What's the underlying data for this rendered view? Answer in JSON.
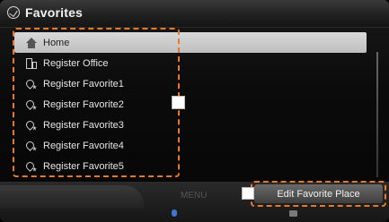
{
  "header": {
    "title": "Favorites",
    "icon": "favorites-icon"
  },
  "favorites": {
    "items": [
      {
        "label": "Home",
        "icon": "home-icon",
        "selected": true
      },
      {
        "label": "Register Office",
        "icon": "office-icon",
        "selected": false
      },
      {
        "label": "Register Favorite1",
        "icon": "favorite-place-icon",
        "selected": false
      },
      {
        "label": "Register Favorite2",
        "icon": "favorite-place-icon",
        "selected": false
      },
      {
        "label": "Register Favorite3",
        "icon": "favorite-place-icon",
        "selected": false
      },
      {
        "label": "Register Favorite4",
        "icon": "favorite-place-icon",
        "selected": false
      },
      {
        "label": "Register Favorite5",
        "icon": "favorite-place-icon",
        "selected": false
      }
    ]
  },
  "footer": {
    "menu_label": "MENU",
    "edit_button_label": "Edit Favorite Place"
  },
  "colors": {
    "highlight_outline": "#e8782a",
    "selected_row": "#cfcfcf",
    "indicator_blue": "#3a78d8"
  }
}
